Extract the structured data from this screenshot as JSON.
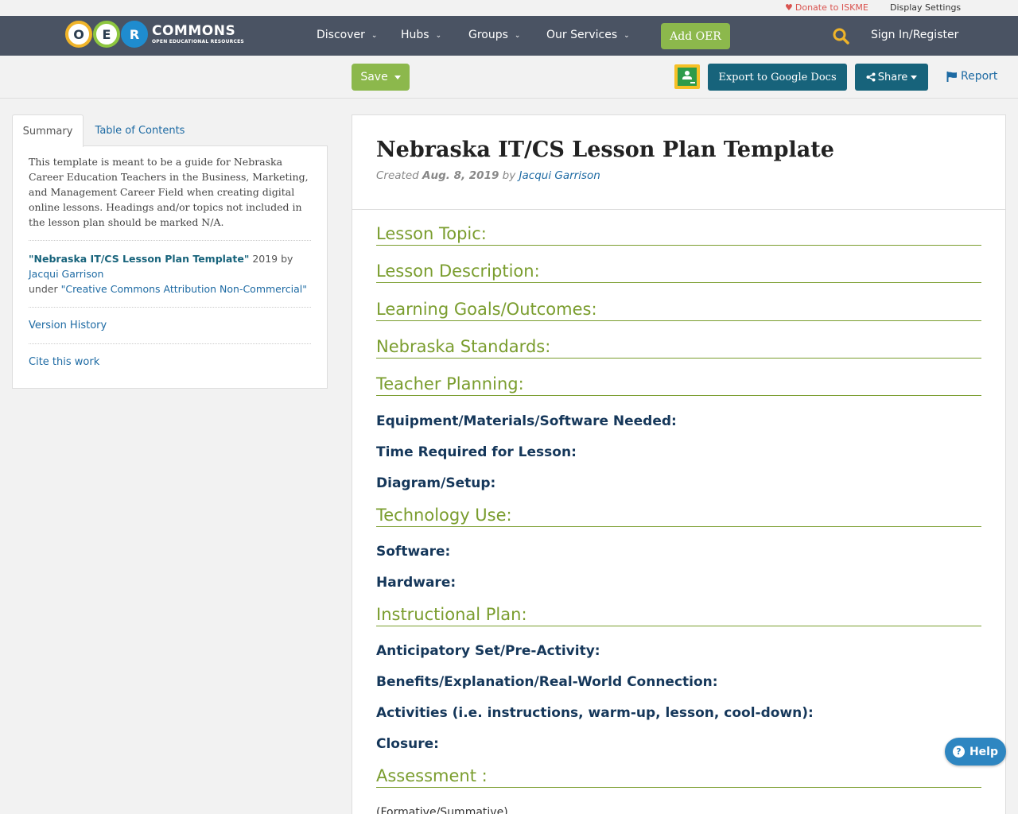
{
  "utility": {
    "donate": "Donate to ISKME",
    "display_settings": "Display Settings"
  },
  "brand": {
    "letters": [
      "O",
      "E",
      "R"
    ],
    "wordmark": "COMMONS",
    "tagline": "OPEN EDUCATIONAL RESOURCES"
  },
  "nav": {
    "discover": "Discover",
    "hubs": "Hubs",
    "groups": "Groups",
    "services": "Our Services",
    "add_oer": "Add OER",
    "sign_in": "Sign In/Register"
  },
  "actions": {
    "save": "Save",
    "export": "Export to Google Docs",
    "share": "Share",
    "report": "Report"
  },
  "sidebar": {
    "tabs": [
      "Summary",
      "Table of Contents"
    ],
    "summary": "This template is meant to be a guide for Nebraska Career Education Teachers in the Business, Marketing, and Management Career Field when creating digital online lessons. Headings and/or topics not included in the lesson plan should be marked N/A.",
    "attribution": {
      "title": "\"Nebraska IT/CS Lesson Plan Template\"",
      "year_by": " 2019 by ",
      "author": "Jacqui Garrison",
      "under": "under ",
      "license": "\"Creative Commons Attribution Non-Commercial\""
    },
    "version_history": "Version History",
    "cite": "Cite this work"
  },
  "document": {
    "title": "Nebraska IT/CS Lesson Plan Template",
    "created_label": "Created ",
    "date": "Aug. 8, 2019",
    "by": " by ",
    "author": "Jacqui Garrison",
    "sections": {
      "lesson_topic": "Lesson Topic:",
      "lesson_description": "Lesson Description:",
      "learning_goals": "Learning Goals/Outcomes:",
      "standards": "Nebraska Standards:",
      "teacher_planning": "Teacher Planning:",
      "technology_use": "Technology Use:",
      "instructional_plan": "Instructional Plan:",
      "assessment": "Assessment :"
    },
    "subsections": {
      "equipment": "Equipment/Materials/Software Needed:",
      "time": "Time Required for Lesson:",
      "diagram": "Diagram/Setup:",
      "software": "Software:",
      "hardware": "Hardware:",
      "anticipatory": "Anticipatory Set/Pre-Activity:",
      "benefits": "Benefits/Explanation/Real-World Connection:",
      "activities": "Activities (i.e. instructions, warm-up, lesson, cool-down):",
      "closure": "Closure:"
    },
    "assessment_note": "(Formative/Summative)"
  },
  "help": {
    "label": "Help"
  },
  "colors": {
    "navbar": "#4a5363",
    "accent_green": "#8cb84c",
    "section_green": "#7a9d2e",
    "button_teal": "#17637b",
    "link_blue": "#1d6aa3",
    "heading_navy": "#15375a"
  }
}
